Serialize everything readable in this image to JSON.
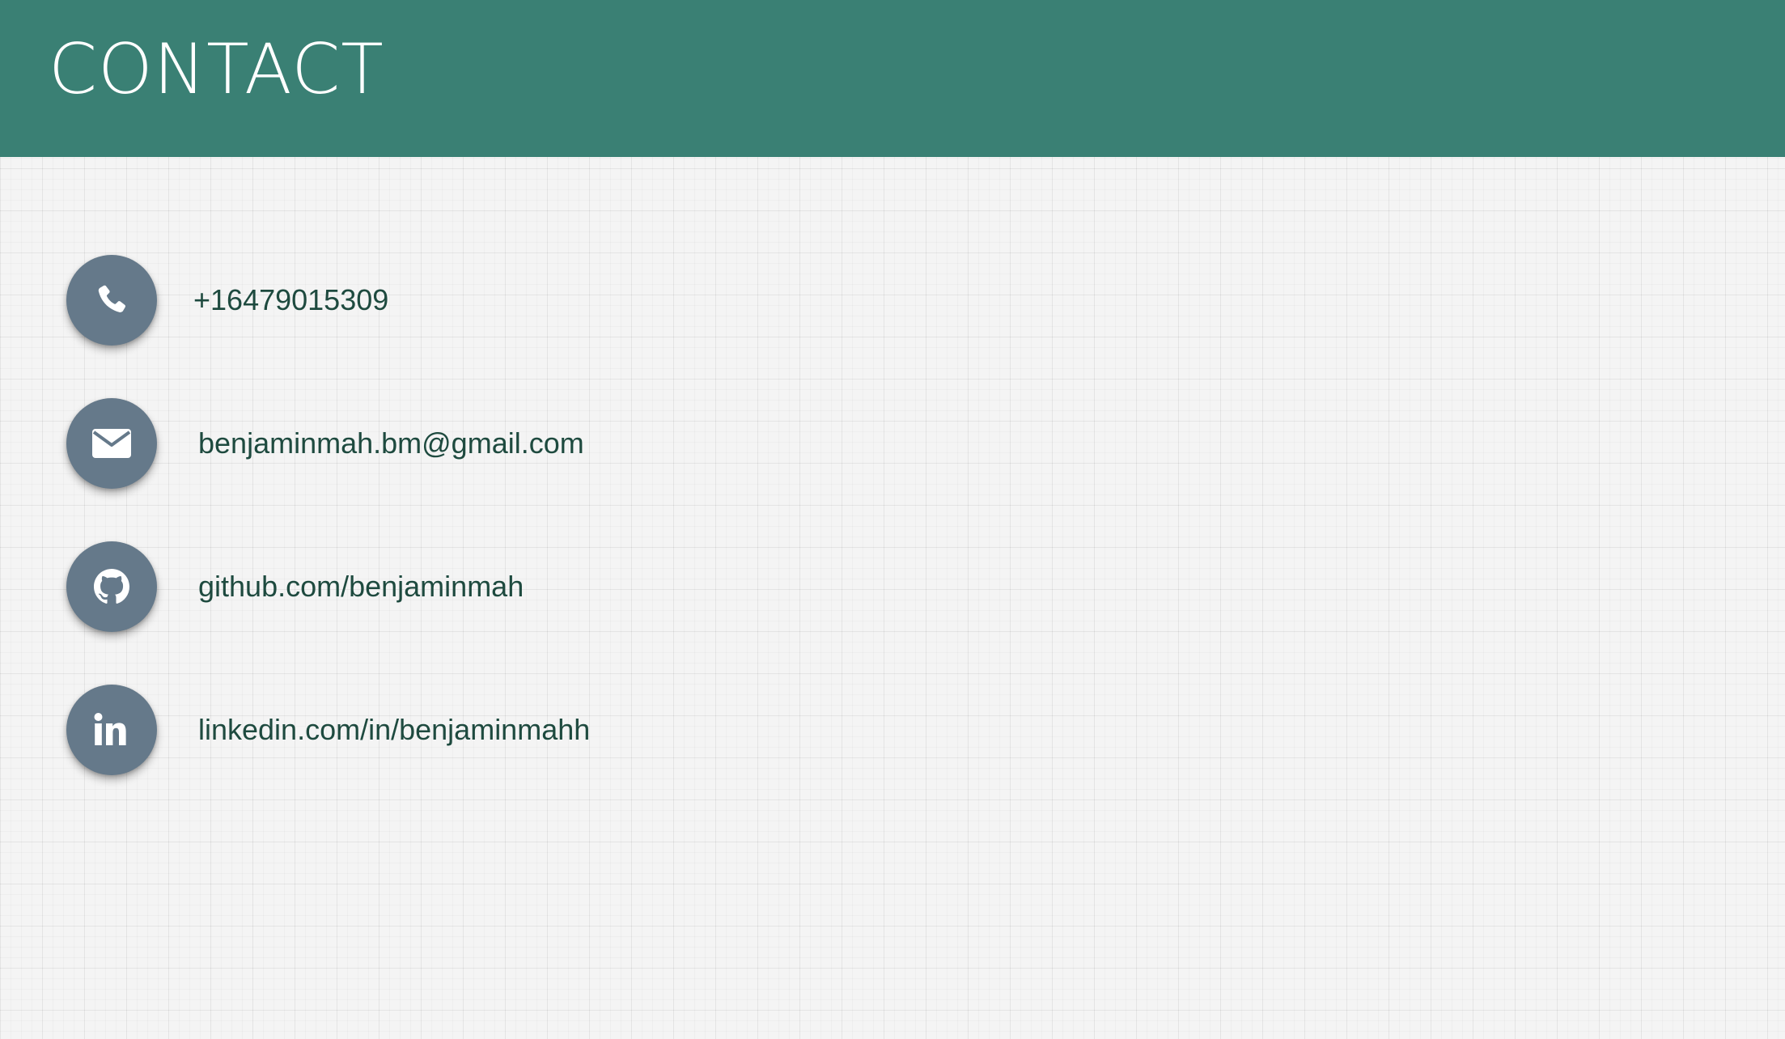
{
  "header": {
    "title": "CONTACT",
    "background": "#3a8074"
  },
  "contacts": [
    {
      "icon": "phone-icon",
      "text": "+16479015309"
    },
    {
      "icon": "email-icon",
      "text": "benjaminmah.bm@gmail.com"
    },
    {
      "icon": "github-icon",
      "text": "github.com/benjaminmah"
    },
    {
      "icon": "linkedin-icon",
      "text": "linkedin.com/in/benjaminmahh"
    }
  ],
  "colors": {
    "icon_circle": "#65798a",
    "text": "#1e4a3f",
    "page_background": "#f4f4f4"
  }
}
